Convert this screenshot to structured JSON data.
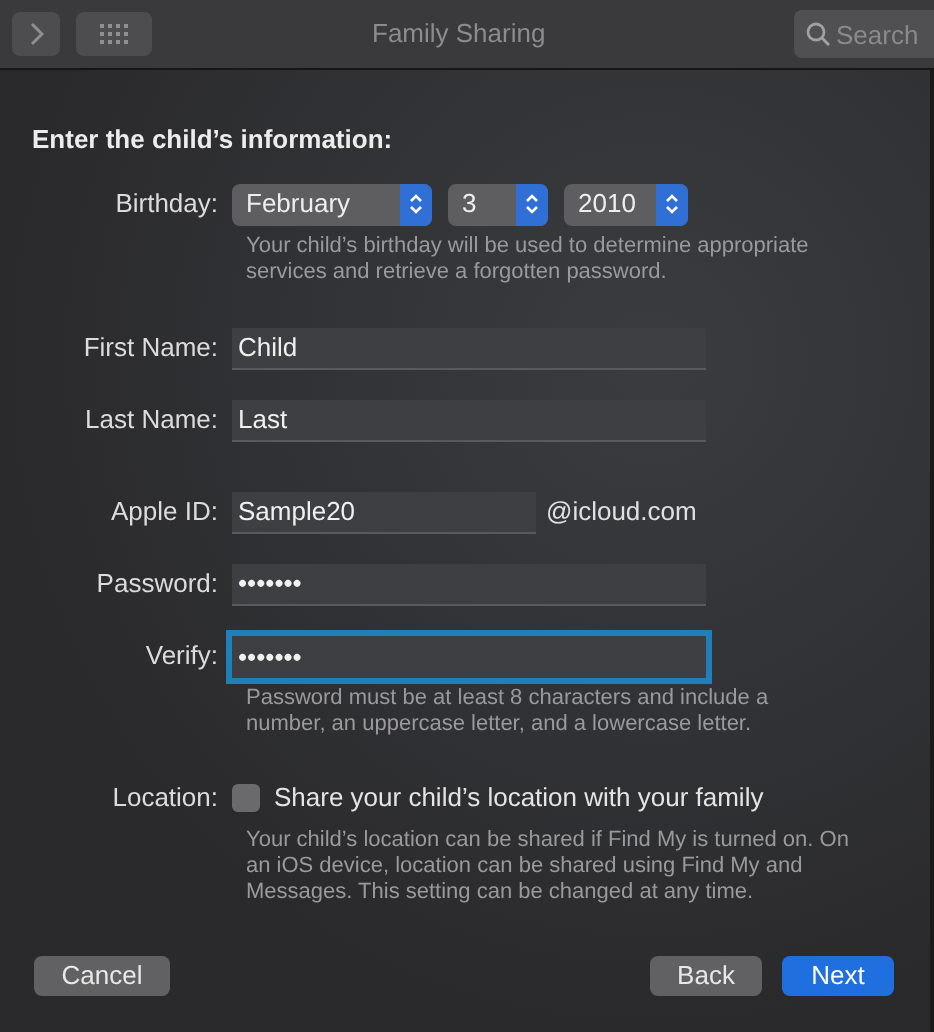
{
  "toolbar": {
    "title": "Family Sharing",
    "search": {
      "placeholder": "Search"
    }
  },
  "heading": "Enter the child’s information:",
  "birthday": {
    "label": "Birthday:",
    "popups": [
      {
        "value": "February"
      },
      {
        "value": "3"
      },
      {
        "value": "2010"
      }
    ],
    "help": "Your child’s birthday will be used to determine appropriate services and retrieve a forgotten password."
  },
  "field_groups": [
    [
      {
        "label": "First Name:",
        "value": "Child",
        "focused": false
      },
      {
        "label": "Last Name:",
        "value": "Last",
        "focused": false
      }
    ],
    [
      {
        "label": "Apple ID:",
        "value": "Sample20",
        "suffix": "@icloud.com",
        "focused": false
      },
      {
        "label": "Password:",
        "value": "•••••••",
        "focused": false
      },
      {
        "label": "Verify:",
        "value": "•••••••",
        "focused": true,
        "help": "Password must be at least 8 characters and include a number, an uppercase letter, and a lowercase letter."
      }
    ]
  ],
  "location": {
    "label": "Location:",
    "checkbox": {
      "label": "Share your child’s location with your family",
      "checked": false
    },
    "help": "Your child’s location can be shared if Find My is turned on. On an iOS device, location can be shared using Find My and Messages. This setting can be changed at any time."
  },
  "buttons": [
    {
      "label": "Cancel",
      "kind": "secondary"
    },
    {
      "label": "Back",
      "kind": "secondary"
    },
    {
      "label": "Next",
      "kind": "primary"
    }
  ]
}
